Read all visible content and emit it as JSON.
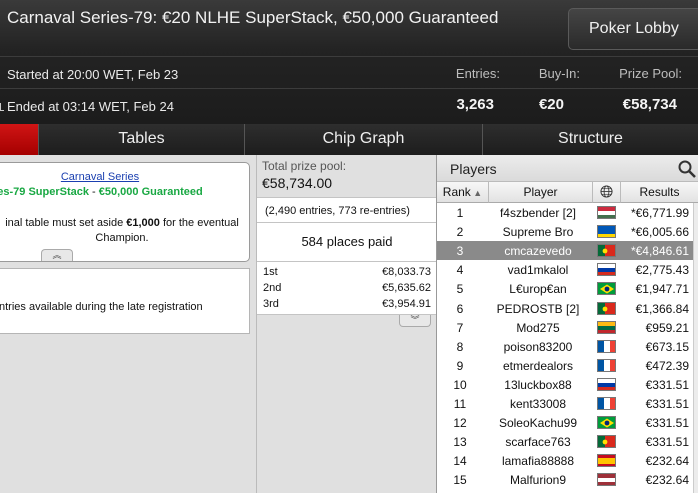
{
  "header": {
    "title": "Carnaval Series-79: €20 NLHE SuperStack, €50,000 Guaranteed",
    "lobby_button": "Poker Lobby",
    "started": "Started at 20:00 WET, Feb 23",
    "ended": "Ended at 03:14 WET, Feb 24",
    "stats": {
      "entries_label": "Entries:",
      "entries_value": "3,263",
      "buyin_label": "Buy-In:",
      "buyin_value": "€20",
      "prize_label": "Prize Pool:",
      "prize_value": "€58,734"
    }
  },
  "tabs": [
    {
      "label": ""
    },
    {
      "label": "Tables"
    },
    {
      "label": "Chip Graph"
    },
    {
      "label": "Structure"
    }
  ],
  "series_box": {
    "link": "Carnaval Series",
    "subtitle_left": "es-79 SuperStack",
    "subtitle_sep": " - ",
    "subtitle_right": "€50,000 Guaranteed",
    "note_line1_pre": "inal table must set aside ",
    "note_line1_bold": "€1,000",
    "note_line1_post": " for the eventual",
    "note_line2": "Champion."
  },
  "reentry_box": {
    "text": "ntries available during the late registration"
  },
  "prize": {
    "label": "Total prize pool:",
    "value": "€58,734.00",
    "entries_note": "(2,490 entries, 773 re-entries)",
    "places_paid": "584 places paid",
    "payouts": [
      {
        "place": "1st",
        "amount": "€8,033.73"
      },
      {
        "place": "2nd",
        "amount": "€5,635.62"
      },
      {
        "place": "3rd",
        "amount": "€3,954.91"
      }
    ]
  },
  "players": {
    "title": "Players",
    "columns": {
      "rank": "Rank",
      "player": "Player",
      "results": "Results"
    },
    "selected_rank": 3,
    "rows": [
      {
        "rank": "1",
        "player": "f4szbender [2]",
        "flag": "hungary",
        "result": "*€6,771.99"
      },
      {
        "rank": "2",
        "player": "Supreme Bro",
        "flag": "ukraine",
        "result": "*€6,005.66"
      },
      {
        "rank": "3",
        "player": "cmcazevedo",
        "flag": "portugal",
        "result": "*€4,846.61"
      },
      {
        "rank": "4",
        "player": "vad1mkalol",
        "flag": "russia",
        "result": "€2,775.43"
      },
      {
        "rank": "5",
        "player": "L€urop€an",
        "flag": "brazil",
        "result": "€1,947.71"
      },
      {
        "rank": "6",
        "player": "PEDROSTB [2]",
        "flag": "portugal",
        "result": "€1,366.84"
      },
      {
        "rank": "7",
        "player": "Mod275",
        "flag": "lithuania",
        "result": "€959.21"
      },
      {
        "rank": "8",
        "player": "poison83200",
        "flag": "france",
        "result": "€673.15"
      },
      {
        "rank": "9",
        "player": "etmerdealors",
        "flag": "france",
        "result": "€472.39"
      },
      {
        "rank": "10",
        "player": "13luckbox88",
        "flag": "russia",
        "result": "€331.51"
      },
      {
        "rank": "11",
        "player": "kent33008",
        "flag": "france",
        "result": "€331.51"
      },
      {
        "rank": "12",
        "player": "SoleoKachu99",
        "flag": "brazil",
        "result": "€331.51"
      },
      {
        "rank": "13",
        "player": "scarface763",
        "flag": "portugal",
        "result": "€331.51"
      },
      {
        "rank": "14",
        "player": "lamafia88888",
        "flag": "spain",
        "result": "€232.64"
      },
      {
        "rank": "15",
        "player": "Malfurion9",
        "flag": "latvia",
        "result": "€232.64"
      }
    ]
  }
}
